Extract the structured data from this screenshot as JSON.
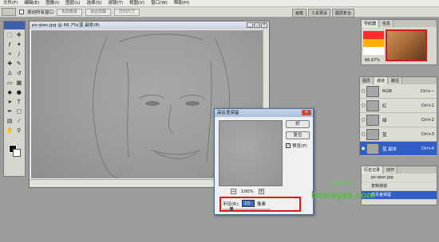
{
  "menu": [
    "文件(F)",
    "编辑(E)",
    "图像(I)",
    "图层(L)",
    "选择(S)",
    "滤镜(T)",
    "视图(V)",
    "窗口(W)",
    "帮助(H)"
  ],
  "options": {
    "checkbox_label": "滚动所有窗口",
    "btn1": "实际像素",
    "btn2": "适合屏幕",
    "btn3": "打印尺寸"
  },
  "palette_tabs": [
    "画笔",
    "工具预设",
    "图层复合"
  ],
  "document": {
    "title": "ps-qian.jpg @ 66.7%(蓝 副本/8)"
  },
  "navigator": {
    "tabs": [
      "导航器",
      "信息"
    ],
    "zoom": "66.67%"
  },
  "channels": {
    "tabs": [
      "图层",
      "通道",
      "路径"
    ],
    "rows": [
      {
        "name": "RGB",
        "shortcut": "Ctrl+~"
      },
      {
        "name": "红",
        "shortcut": "Ctrl+1"
      },
      {
        "name": "绿",
        "shortcut": "Ctrl+2"
      },
      {
        "name": "蓝",
        "shortcut": "Ctrl+3"
      },
      {
        "name": "蓝 副本",
        "shortcut": "Ctrl+4"
      }
    ]
  },
  "history": {
    "tabs": [
      "历史记录",
      "动作"
    ],
    "rows": [
      "ps-qian.jpg",
      "复制通道",
      "高反差保留"
    ]
  },
  "dialog": {
    "title": "高反差保留",
    "ok": "好",
    "reset": "复位",
    "preview": "预览(P)",
    "zoom": "100%",
    "radius_label": "半径(R):",
    "radius_value": "10",
    "radius_unit": "像素"
  },
  "watermark": {
    "text": "beareyes.com",
    "cn": "小熊在线"
  }
}
